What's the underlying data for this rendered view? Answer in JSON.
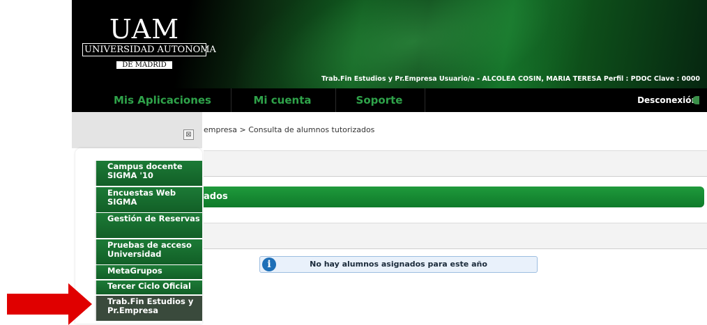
{
  "header": {
    "logo": {
      "mark": "UAM",
      "univ": "UNIVERSIDAD AUTONOMA",
      "madrid": "DE MADRID"
    },
    "info": "Trab.Fin Estudios y Pr.Empresa  Usuario/a - ALCOLEA COSIN, MARIA TERESA  Perfil : PDOC  Clave : 0000"
  },
  "nav": {
    "items": [
      {
        "label": "Mis Aplicaciones"
      },
      {
        "label": "Mi cuenta"
      },
      {
        "label": "Soporte"
      }
    ],
    "logout": "Desconexión"
  },
  "breadcrumb": "empresa > Consulta de alumnos tutorizados",
  "section_title": "ados",
  "message": "No hay alumnos asignados para este año",
  "apps_menu": {
    "items": [
      {
        "label": "Campus docente SIGMA '10"
      },
      {
        "label": "Encuestas Web SIGMA"
      },
      {
        "label": "Gestión de Reservas"
      },
      {
        "label": "Pruebas de acceso Universidad"
      },
      {
        "label": "MetaGrupos"
      },
      {
        "label": "Tercer Ciclo Oficial"
      },
      {
        "label": "Trab.Fin Estudios y Pr.Empresa"
      }
    ],
    "active_index": 6
  },
  "colors": {
    "accent": "#2fa34a",
    "menu_green": "#1c7a36",
    "arrow": "#e00000"
  }
}
